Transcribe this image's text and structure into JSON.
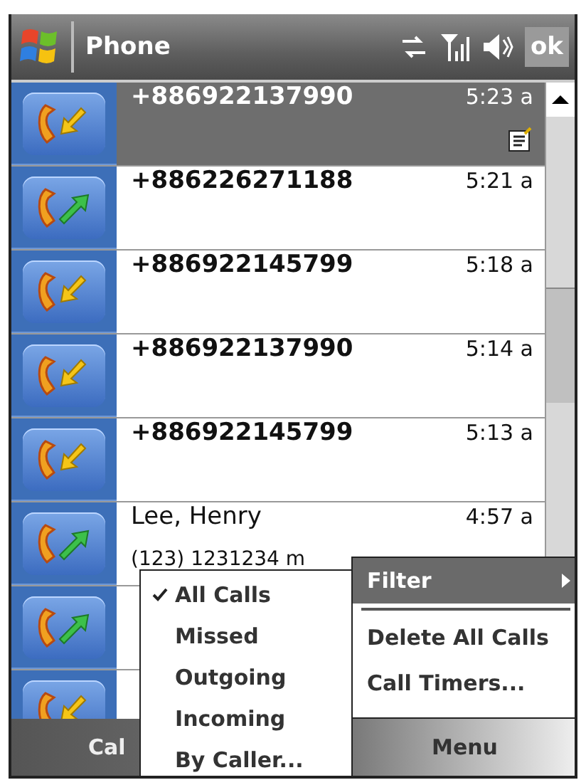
{
  "title_bar": {
    "title": "Phone",
    "ok": "ok"
  },
  "calls": [
    {
      "kind": "incoming",
      "number": "+886922137990",
      "time": "5:23 a",
      "selected": true,
      "note": true
    },
    {
      "kind": "outgoing",
      "number": "+886226271188",
      "time": "5:21 a",
      "selected": false,
      "note": false
    },
    {
      "kind": "incoming",
      "number": "+886922145799",
      "time": "5:18 a",
      "selected": false,
      "note": false
    },
    {
      "kind": "incoming",
      "number": "+886922137990",
      "time": "5:14 a",
      "selected": false,
      "note": false
    },
    {
      "kind": "incoming",
      "number": "+886922145799",
      "time": "5:13 a",
      "selected": false,
      "note": false
    },
    {
      "kind": "outgoing",
      "number": "Lee, Henry",
      "detail": "(123) 1231234 m",
      "time": "4:57 a",
      "selected": false,
      "note": false
    },
    {
      "kind": "outgoing",
      "selected": false,
      "note": false
    },
    {
      "kind": "incoming",
      "selected": false,
      "note": false
    }
  ],
  "menu": {
    "items": [
      {
        "kind": "submenu",
        "label": "Filter",
        "selected": true
      },
      {
        "kind": "divider"
      },
      {
        "kind": "item",
        "label": "Delete All Calls",
        "selected": false
      },
      {
        "kind": "item",
        "label": "Call Timers...",
        "selected": false
      }
    ],
    "submenu": [
      {
        "label": "All Calls",
        "checked": true
      },
      {
        "label": "Missed",
        "checked": false
      },
      {
        "label": "Outgoing",
        "checked": false
      },
      {
        "label": "Incoming",
        "checked": false
      },
      {
        "label": "By Caller...",
        "checked": false
      }
    ]
  },
  "soft_keys": {
    "left": "Cal",
    "right": "Menu"
  }
}
